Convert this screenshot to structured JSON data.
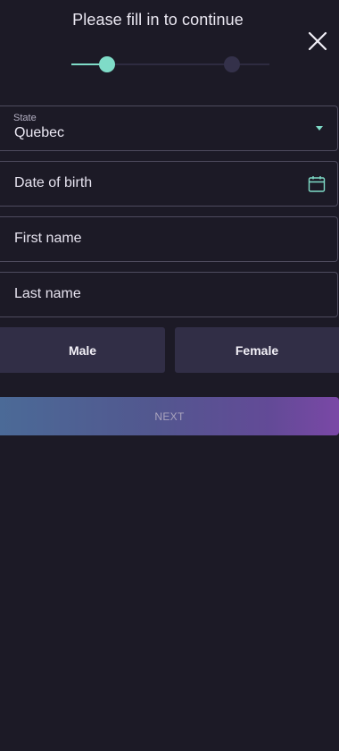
{
  "header": {
    "title": "Please fill in to continue"
  },
  "progress": {
    "current_step": 1,
    "total_steps": 2
  },
  "form": {
    "state": {
      "label": "State",
      "value": "Quebec"
    },
    "date_of_birth": {
      "placeholder": "Date of birth"
    },
    "first_name": {
      "placeholder": "First name"
    },
    "last_name": {
      "placeholder": "Last name"
    },
    "gender": {
      "male_label": "Male",
      "female_label": "Female"
    }
  },
  "actions": {
    "next_label": "NEXT"
  },
  "colors": {
    "background": "#1c1a26",
    "accent": "#7fdcc8",
    "field_border": "#4e4b5e",
    "button_bg": "#312e46",
    "next_gradient_start": "#4b6a97",
    "next_gradient_end": "#7a48a6"
  },
  "icons": {
    "close": "close-icon",
    "dropdown": "chevron-down-icon",
    "calendar": "calendar-icon"
  }
}
